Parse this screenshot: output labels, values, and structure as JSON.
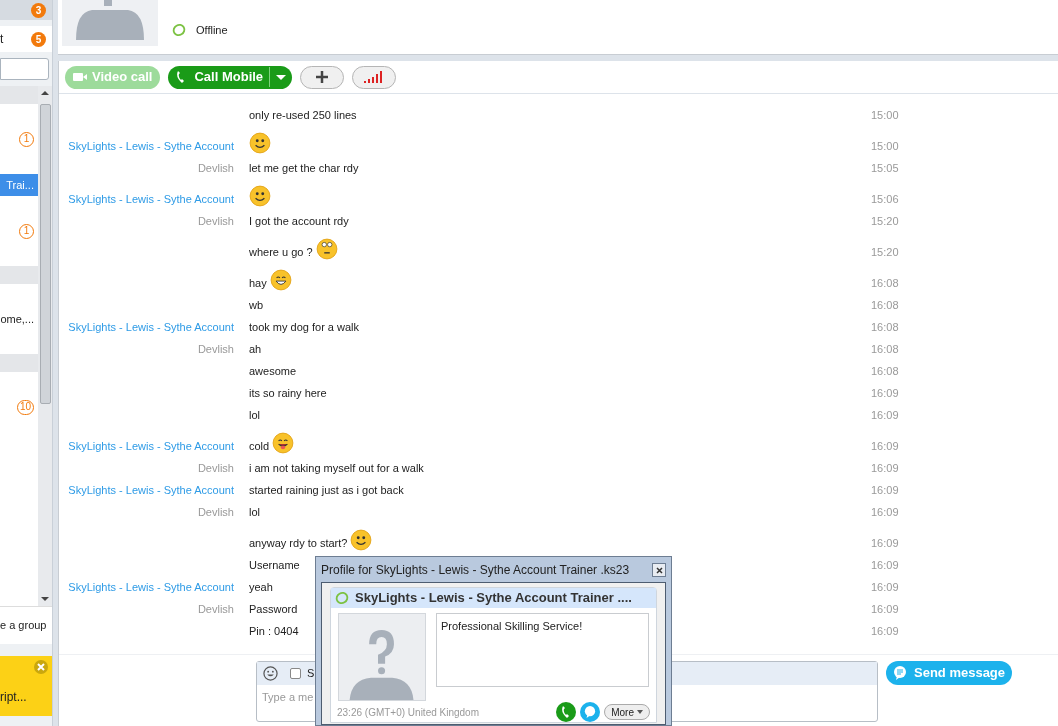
{
  "sidebar": {
    "tabs": [
      {
        "badge": "3",
        "selected": false
      },
      {
        "label": "t",
        "badge": "5",
        "selected": true
      }
    ],
    "contacts": [
      {
        "kind": "header"
      },
      {
        "kind": "contact",
        "badge": "1",
        "selected": false
      },
      {
        "kind": "contact",
        "name": "Trai...",
        "selected": true
      },
      {
        "kind": "contact",
        "badge": "1",
        "selected": false
      },
      {
        "kind": "header"
      },
      {
        "kind": "contact",
        "name": "ome,...",
        "selected": false
      },
      {
        "kind": "header"
      },
      {
        "kind": "contact",
        "badge": "10",
        "selected": false
      }
    ],
    "create_group": "e a group",
    "notification": {
      "text": "ript..."
    }
  },
  "profile": {
    "status": "Offline"
  },
  "toolbar": {
    "video_call": {
      "label": "Video call",
      "disabled": true
    },
    "call_mobile": {
      "label": "Call Mobile"
    }
  },
  "messages": [
    {
      "text": "only re-used 250 lines",
      "time": "15:00"
    },
    {
      "sender": "SkyLights - Lewis - Sythe Account",
      "kind": "remote",
      "emoji": {
        "kind": "smile"
      },
      "time": "15:00"
    },
    {
      "sender": "Devlish",
      "kind": "local",
      "text": "let me get the char rdy",
      "time": "15:05"
    },
    {
      "sender": "SkyLights - Lewis - Sythe Account",
      "kind": "remote",
      "emoji": {
        "kind": "smile"
      },
      "time": "15:06"
    },
    {
      "sender": "Devlish",
      "kind": "local",
      "text": "I got the account rdy",
      "time": "15:20"
    },
    {
      "text": "where u go ?",
      "emoji": {
        "kind": "roll"
      },
      "time": "15:20"
    },
    {
      "text": "hay",
      "emoji": {
        "kind": "grin"
      },
      "time": "16:08"
    },
    {
      "text": "wb",
      "time": "16:08"
    },
    {
      "sender": "SkyLights - Lewis - Sythe Account",
      "kind": "remote",
      "text": "took my dog for a walk",
      "time": "16:08"
    },
    {
      "sender": "Devlish",
      "kind": "local",
      "text": "ah",
      "time": "16:08"
    },
    {
      "text": "awesome",
      "time": "16:08"
    },
    {
      "text": "its so rainy here",
      "time": "16:09"
    },
    {
      "text": "lol",
      "time": "16:09"
    },
    {
      "sender": "SkyLights - Lewis - Sythe Account",
      "kind": "remote",
      "text": "cold",
      "emoji": {
        "kind": "tongue"
      },
      "time": "16:09"
    },
    {
      "sender": "Devlish",
      "kind": "local",
      "text": "i am not taking myself out for a walk",
      "time": "16:09"
    },
    {
      "sender": "SkyLights - Lewis - Sythe Account",
      "kind": "remote",
      "text": "started raining just as i got back",
      "time": "16:09"
    },
    {
      "sender": "Devlish",
      "kind": "local",
      "text": "lol",
      "time": "16:09"
    },
    {
      "text": "anyway rdy to start?",
      "emoji": {
        "kind": "smile"
      },
      "time": "16:09"
    },
    {
      "text": "Username",
      "time": "16:09"
    },
    {
      "sender": "SkyLights - Lewis - Sythe Account",
      "kind": "remote",
      "text": "yeah",
      "time": "16:09"
    },
    {
      "sender": "Devlish",
      "kind": "local",
      "text": "Password",
      "time": "16:09"
    },
    {
      "text": "Pin : 0404",
      "time": "16:09"
    }
  ],
  "composer": {
    "sms_label": "S",
    "sms_checked": false,
    "placeholder": "Type a me",
    "send": "Send message"
  },
  "profile_popup": {
    "title": "Profile for SkyLights - Lewis - Sythe Account Trainer .ks23",
    "name": "SkyLights - Lewis - Sythe Account Trainer ....",
    "mood": "Professional Skilling Service!",
    "location": "23:26 (GMT+0)  United Kingdom",
    "more": "More"
  }
}
